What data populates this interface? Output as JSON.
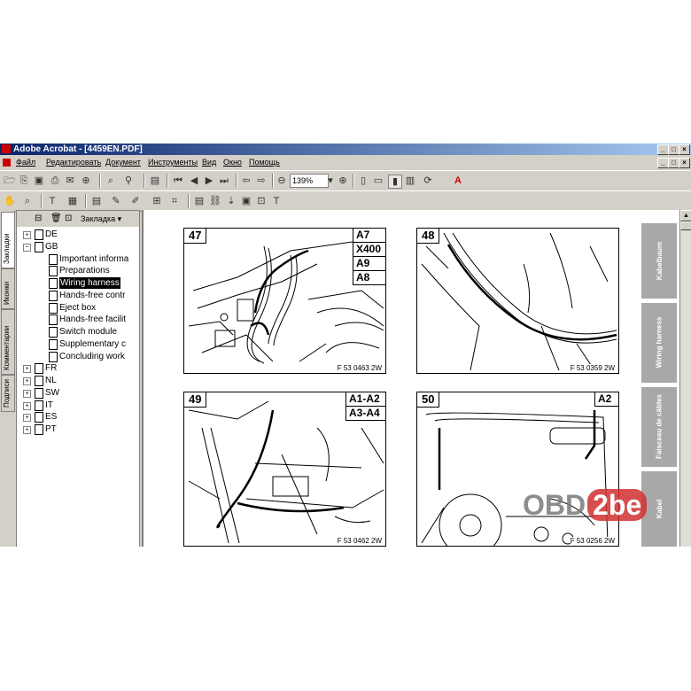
{
  "window": {
    "title": "Adobe Acrobat - [4459EN.PDF]"
  },
  "menu": {
    "items": [
      "Файл",
      "Редактировать",
      "Документ",
      "Инструменты",
      "Вид",
      "Окно",
      "Помощь"
    ]
  },
  "toolbar": {
    "zoom_value": "139%"
  },
  "left_tabs": [
    "Закладки",
    "Иконки",
    "Комментарии",
    "Подписи"
  ],
  "bookmarks": {
    "header_label": "Закладка ▾",
    "tree": [
      {
        "label": "DE",
        "expand": "+"
      },
      {
        "label": "GB",
        "expand": "−"
      },
      {
        "label": "Important informa"
      },
      {
        "label": "Preparations"
      },
      {
        "label": "Wiring harness",
        "selected": true
      },
      {
        "label": "Hands-free contr"
      },
      {
        "label": "Eject box"
      },
      {
        "label": "Hands-free facilit"
      },
      {
        "label": "Switch module"
      },
      {
        "label": "Supplementary c"
      },
      {
        "label": "Concluding work"
      },
      {
        "label": "FR",
        "expand": "+"
      },
      {
        "label": "NL",
        "expand": "+"
      },
      {
        "label": "SW",
        "expand": "+"
      },
      {
        "label": "IT",
        "expand": "+"
      },
      {
        "label": "ES",
        "expand": "+"
      },
      {
        "label": "PT",
        "expand": "+"
      }
    ]
  },
  "document": {
    "figures": [
      {
        "number": "47",
        "labels": [
          "A7",
          "X400",
          "A9",
          "A8"
        ],
        "code": "F 53 0463 2W"
      },
      {
        "number": "48",
        "labels": [],
        "code": "F 53 0359 2W"
      },
      {
        "number": "49",
        "labels": [
          "A1-A2",
          "A3-A4"
        ],
        "code": "F 53 0462 2W"
      },
      {
        "number": "50",
        "labels": [
          "A2"
        ],
        "code": "F 53 0256 2W"
      }
    ],
    "side_tabs": [
      "Kabelbaum",
      "Wiring harness",
      "Faisceau de câbles",
      "Kabel"
    ],
    "watermark_a": "OBD",
    "watermark_b": "2be"
  }
}
